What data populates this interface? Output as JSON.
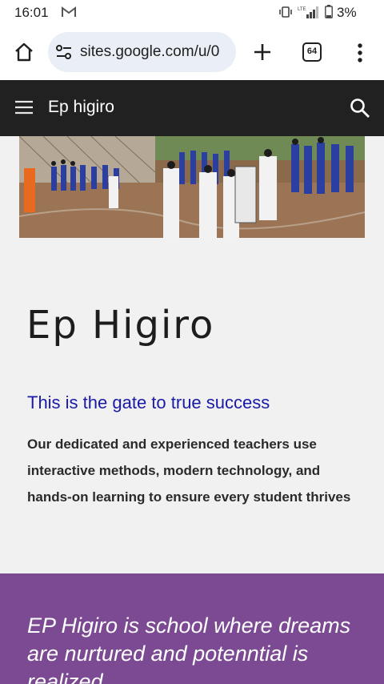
{
  "status_bar": {
    "time": "16:01",
    "network": "LTE",
    "battery": "3%",
    "icons": [
      "gmail-icon",
      "vibrate-icon",
      "signal-icon",
      "battery-icon"
    ]
  },
  "browser": {
    "url": "sites.google.com/u/0",
    "tab_count": "64",
    "icons": [
      "home-icon",
      "tune-icon",
      "plus-icon",
      "more-vert-icon"
    ]
  },
  "site_header": {
    "title": "Ep higiro",
    "icons": [
      "menu-icon",
      "search-icon"
    ],
    "background": "#212121"
  },
  "hero": {
    "image": "photo of students in blue uniforms gathered in a school courtyard"
  },
  "main": {
    "heading": "Ep Higiro",
    "tagline": "This is the gate to true success",
    "description": "Our dedicated and experienced teachers use interactive methods, modern technology, and hands-on learning to ensure every student thrives",
    "tagline_color": "#1a1aa8"
  },
  "band": {
    "quote": "EP Higiro is school where dreams are nurtured and potenntial is realized",
    "color": "#7b4a93"
  }
}
